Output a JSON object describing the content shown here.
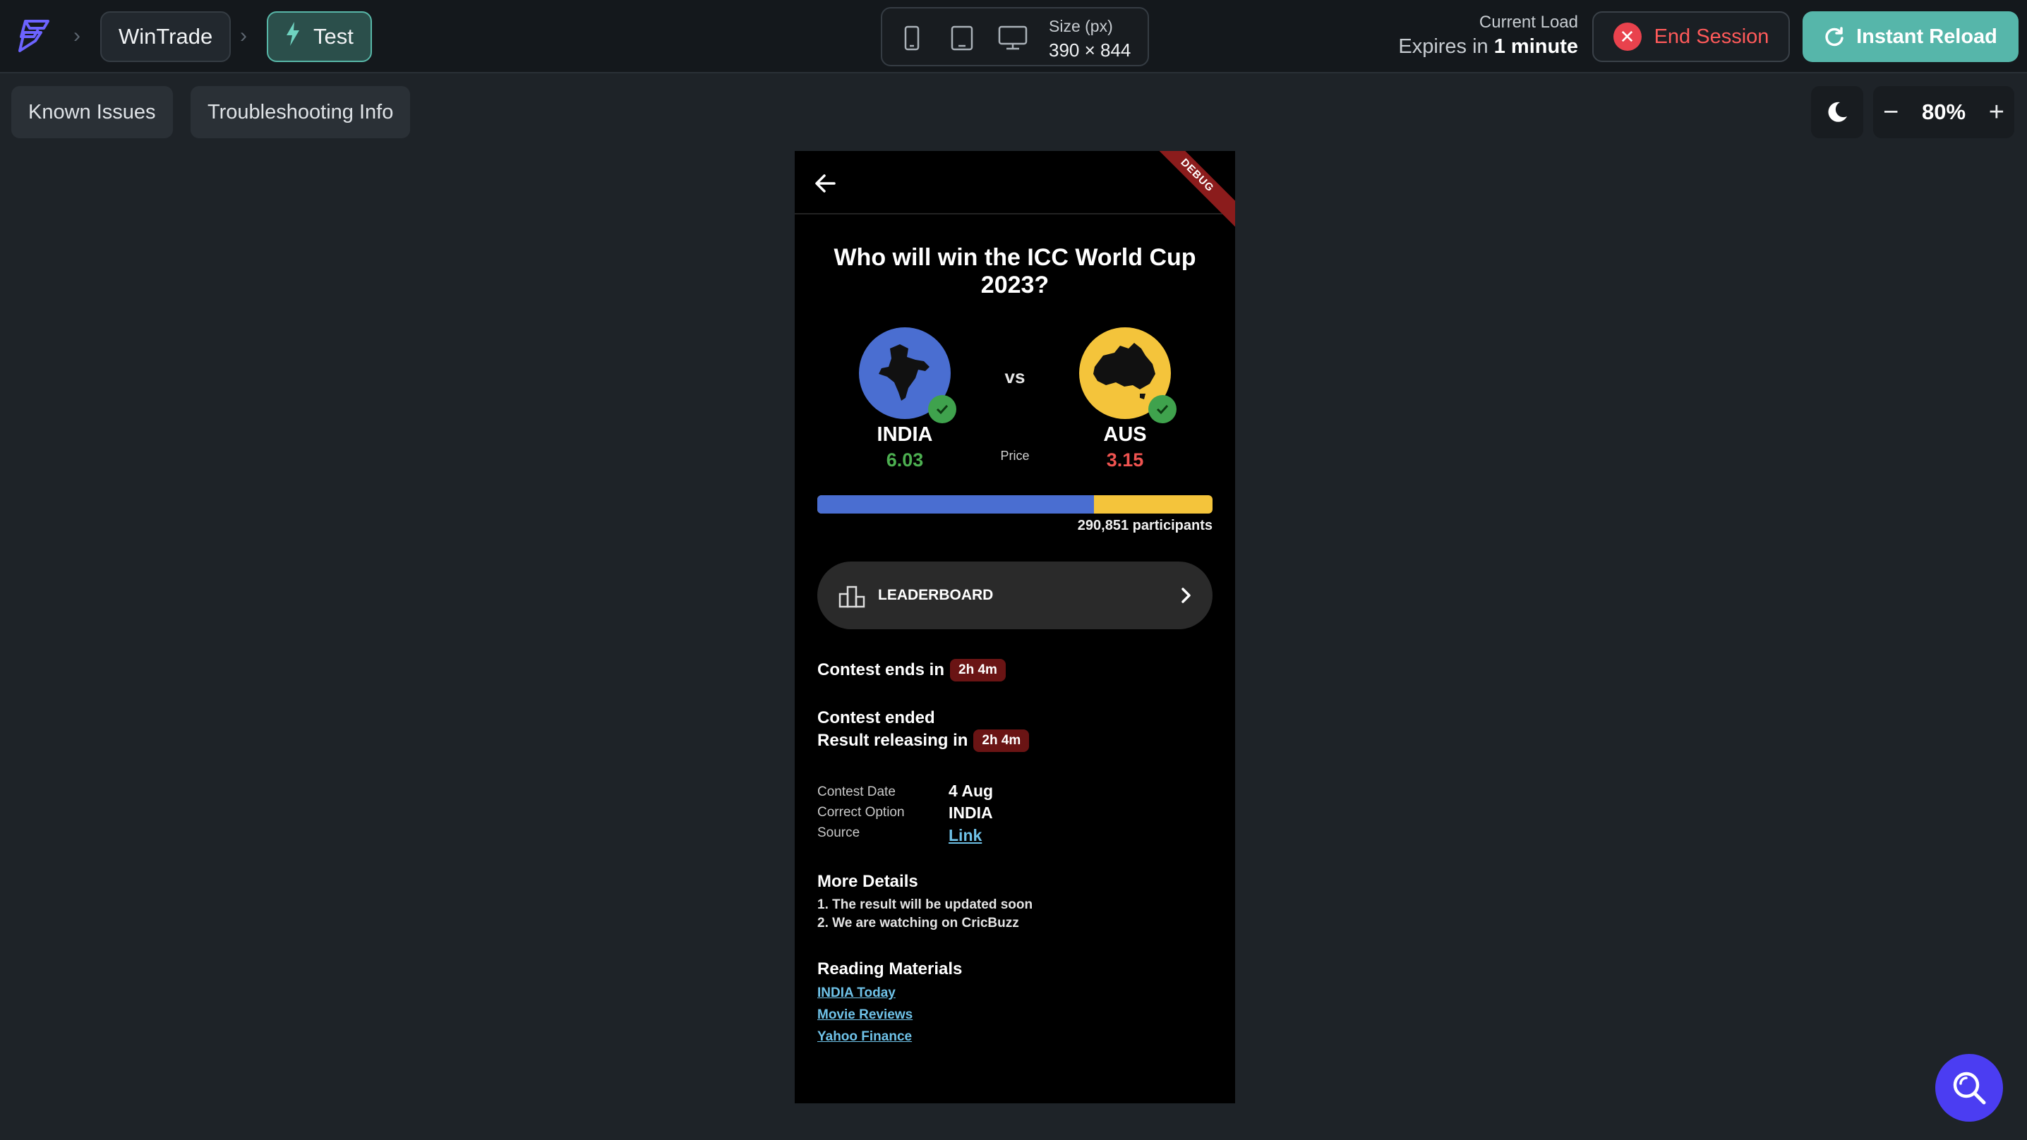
{
  "topbar": {
    "project": "WinTrade",
    "branch": "Test",
    "size_label": "Size (px)",
    "size_value": "390 × 844",
    "load_label": "Current Load",
    "expires_prefix": "Expires in",
    "expires_value": "1 minute",
    "end_session": "End Session",
    "instant_reload": "Instant Reload"
  },
  "toolbar": {
    "known_issues": "Known Issues",
    "troubleshooting": "Troubleshooting Info",
    "zoom": "80%"
  },
  "app": {
    "debug_banner": "DEBUG",
    "question": "Who will win the ICC World Cup 2023?",
    "vs": "vs",
    "price_label": "Price",
    "team_a": {
      "name": "INDIA",
      "price": "6.03",
      "color": "#4a6ed1",
      "price_color": "#4caf50"
    },
    "team_b": {
      "name": "AUS",
      "price": "3.15",
      "color": "#f4c43b",
      "price_color": "#ef5350"
    },
    "split_fraction": 0.7,
    "participants": "290,851 participants",
    "leaderboard": "LEADERBOARD",
    "contest_ends_label": "Contest ends in",
    "contest_ends_value": "2h 4m",
    "contest_ended": "Contest ended",
    "result_label": "Result releasing in",
    "result_value": "2h 4m",
    "details": [
      {
        "key": "Contest Date",
        "value": "4 Aug"
      },
      {
        "key": "Correct Option",
        "value": "INDIA"
      },
      {
        "key": "Source",
        "value": "Link"
      }
    ],
    "more_details_title": "More Details",
    "more_details": [
      "1. The result will be updated soon",
      "2. We are watching on CricBuzz"
    ],
    "reading_title": "Reading Materials",
    "reading": [
      "INDIA Today",
      "Movie Reviews",
      "Yahoo Finance"
    ]
  }
}
